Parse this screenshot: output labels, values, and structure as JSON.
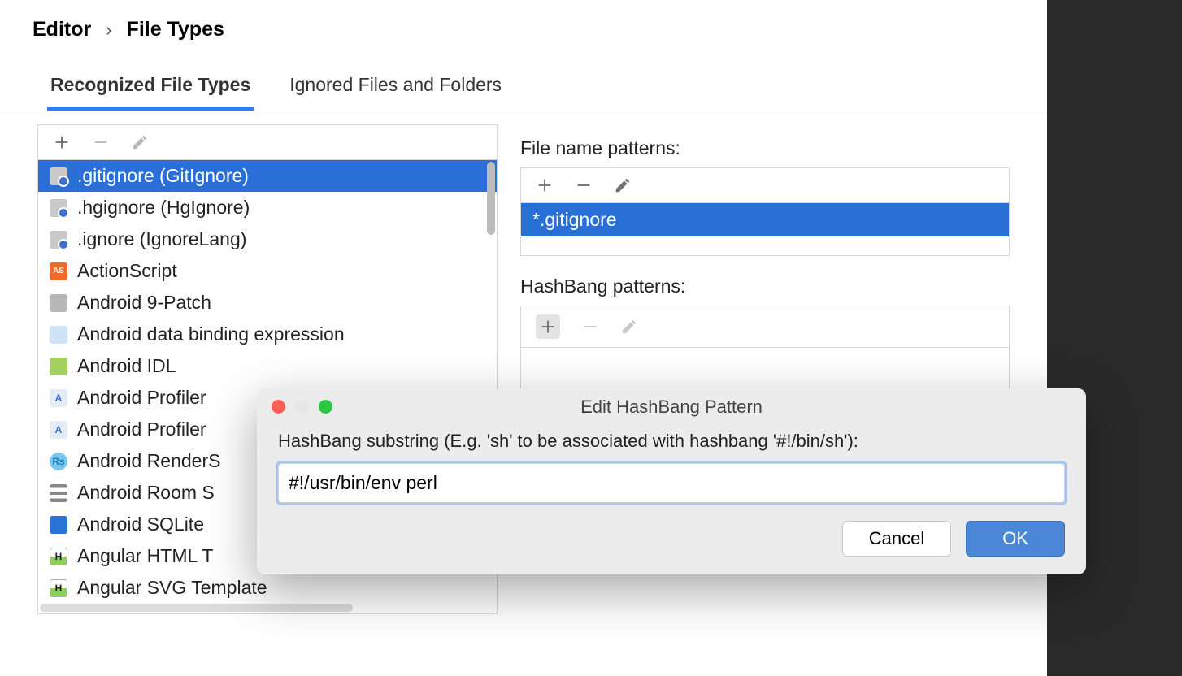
{
  "breadcrumb": {
    "parent": "Editor",
    "current": "File Types"
  },
  "tabs": [
    {
      "label": "Recognized File Types",
      "active": true
    },
    {
      "label": "Ignored Files and Folders",
      "active": false
    }
  ],
  "filetypes_label": "Recognized File Types",
  "filetypes": [
    {
      "label": ".gitignore (GitIgnore)",
      "icon": "ic-ignore",
      "selected": true
    },
    {
      "label": ".hgignore (HgIgnore)",
      "icon": "ic-ignore"
    },
    {
      "label": ".ignore (IgnoreLang)",
      "icon": "ic-ignore"
    },
    {
      "label": "ActionScript",
      "icon": "ic-as",
      "iconText": "AS"
    },
    {
      "label": "Android 9-Patch",
      "icon": "ic-folder"
    },
    {
      "label": "Android data binding expression",
      "icon": "ic-adbe"
    },
    {
      "label": "Android IDL",
      "icon": "ic-aidl"
    },
    {
      "label": "Android Profiler",
      "icon": "ic-aprof",
      "iconText": "A"
    },
    {
      "label": "Android Profiler",
      "icon": "ic-aprof",
      "iconText": "A"
    },
    {
      "label": "Android RenderS",
      "icon": "ic-rs",
      "iconText": "Rs"
    },
    {
      "label": "Android Room S",
      "icon": "ic-rows"
    },
    {
      "label": "Android SQLite",
      "icon": "ic-sqlite"
    },
    {
      "label": "Angular HTML T",
      "icon": "ic-ang",
      "iconText": "H"
    },
    {
      "label": "Angular SVG Template",
      "icon": "ic-ang",
      "iconText": "H"
    }
  ],
  "fname_section": "File name patterns:",
  "fname_patterns": [
    {
      "label": "*.gitignore",
      "selected": true
    }
  ],
  "hashbang_section": "HashBang patterns:",
  "dialog": {
    "title": "Edit HashBang Pattern",
    "label": "HashBang substring (E.g. 'sh' to be associated with hashbang '#!/bin/sh'):",
    "value": "#!/usr/bin/env perl",
    "cancel": "Cancel",
    "ok": "OK"
  },
  "icons": {
    "plus": "+",
    "minus": "−",
    "edit": "✎"
  }
}
